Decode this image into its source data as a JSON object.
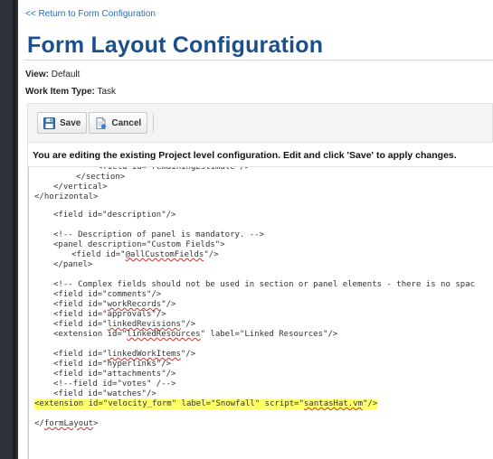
{
  "nav": {
    "return_link": "<< Return to Form Configuration"
  },
  "header": {
    "title": "Form Layout Configuration"
  },
  "meta": {
    "view_label": "View:",
    "view_value": "Default",
    "work_item_label": "Work Item Type:",
    "work_item_value": "Task"
  },
  "toolbar": {
    "save_label": "Save",
    "cancel_label": "Cancel"
  },
  "notice": "You are editing the existing Project level configuration. Edit and click 'Save' to apply changes.",
  "editor": {
    "lines": [
      {
        "text": "<field id=\"remainingEstimate\"/>"
      },
      {
        "text": "</section>"
      },
      {
        "text": "</vertical>"
      },
      {
        "text": "</horizontal>"
      },
      {
        "text": "<field id=\"description\"/>"
      },
      {
        "text": "<!-- Description of panel is mandatory. -->"
      },
      {
        "text": "<panel description=\"Custom Fields\">"
      },
      {
        "pre": "<field id=\"",
        "sq": "@allCustomFields",
        "post": "\"/>"
      },
      {
        "text": "</panel>"
      },
      {
        "text": "<!-- Complex fields should not be used in section or panel elements - there is no spac"
      },
      {
        "text": "<field id=\"comments\"/>"
      },
      {
        "pre": "<field id=\"",
        "sq": "workRecords",
        "post": "\"/>"
      },
      {
        "text": "<field id=\"approvals\"/>"
      },
      {
        "pre": "<field id=\"",
        "sq": "linkedRevisions",
        "post": "\"/>"
      },
      {
        "pre": "<extension id=\"",
        "sq": "linkedResources",
        "post": "\" label=\"Linked Resources\"/>"
      },
      {
        "pre": "<field id=\"",
        "sq": "linkedWorkItems",
        "post": "\"/>"
      },
      {
        "text": "<field id=\"hyperlinks\"/>"
      },
      {
        "text": "<field id=\"attachments\"/>"
      },
      {
        "text": "<!--field id=\"votes\" /-->"
      },
      {
        "text": "<field id=\"watches\"/>"
      },
      {
        "pre": "<extension id=\"velocity_form\" label=\"Snowfall\" script=\"",
        "sq": "santasHat.vm",
        "post": "\"/>"
      },
      {
        "pre": "</",
        "sq": "formLayout",
        "post": ">"
      }
    ]
  },
  "colors": {
    "title": "#1a4f8c",
    "link": "#2a6ebb",
    "highlight": "#ffff66",
    "sidebar": "#2f3238",
    "squiggle": "#d2342b"
  },
  "icons": {
    "save": "floppy-disk-icon",
    "cancel": "cancel-document-icon"
  }
}
